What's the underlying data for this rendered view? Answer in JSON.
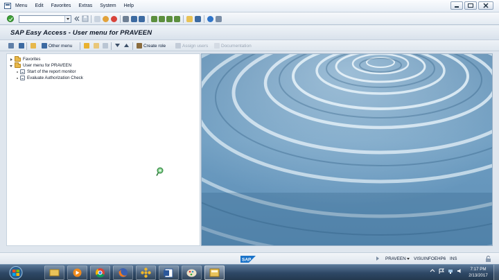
{
  "menubar": {
    "items": [
      "Menu",
      "Edit",
      "Favorites",
      "Extras",
      "System",
      "Help"
    ]
  },
  "toolbar": {
    "command_value": ""
  },
  "title": "SAP Easy Access  -  User menu for PRAVEEN",
  "app_toolbar": {
    "other_menu": "Other menu",
    "create_role": "Create role",
    "assign_users": "Assign users",
    "documentation": "Documentation"
  },
  "tree": {
    "favorites": "Favorites",
    "user_menu": "User menu for PRAVEEN",
    "items": [
      "Start of the report monitor",
      "Evaluate Authorization Check"
    ]
  },
  "statusbar": {
    "logo": "SAP",
    "user": "PRAVEEN",
    "server": "VISUINFOEHP6",
    "mode": "INS"
  },
  "taskbar": {
    "time": "7:17 PM",
    "date": "2/13/2017"
  },
  "colors": {
    "accent": "#3fa339",
    "water": "#4d7ea4"
  }
}
